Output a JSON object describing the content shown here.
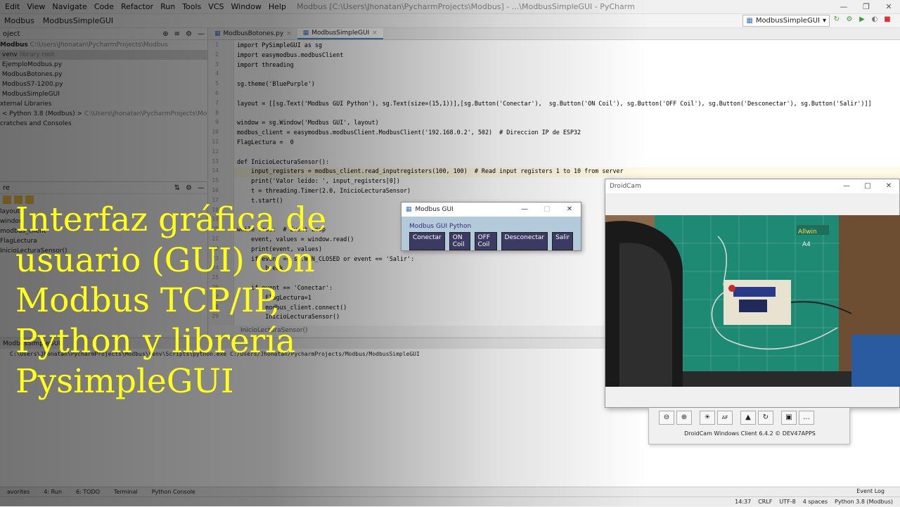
{
  "menu": {
    "items": [
      "Edit",
      "View",
      "Navigate",
      "Code",
      "Refactor",
      "Run",
      "Tools",
      "VCS",
      "Window",
      "Help"
    ],
    "window_title": "Modbus [C:\\Users\\Jhonatan\\PycharmProjects\\Modbus] - ...\\ModbusSimpleGUI - PyCharm"
  },
  "navbar": {
    "crumbs": [
      "Modbus",
      "ModbusSimpleGUI"
    ]
  },
  "run_config": "ModbusSimpleGUI",
  "project": {
    "header": "oject",
    "tree": [
      {
        "name": "Modbus",
        "path": "C:\\Users\\Jhonatan\\PycharmProjects\\Modbus"
      },
      {
        "name": "venv",
        "path": "library root"
      },
      {
        "name": "EjemploModbus.py",
        "path": ""
      },
      {
        "name": "ModbusBotones.py",
        "path": ""
      },
      {
        "name": "ModbusS7-1200.py",
        "path": ""
      },
      {
        "name": "ModbusSimpleGUI",
        "path": ""
      },
      {
        "name": "xternal Libraries",
        "path": ""
      },
      {
        "name": "< Python 3.8 (Modbus) >",
        "path": "C:\\Users\\Jhonatan\\PycharmProjects\\Modbus\\venv\\"
      },
      {
        "name": "cratches and Consoles",
        "path": ""
      }
    ]
  },
  "structure": {
    "header": "re",
    "items": [
      "layout",
      "window",
      "modbus_client",
      "FlagLectura",
      "InicioLecturaSensor()"
    ]
  },
  "tabs": [
    {
      "label": "ModbusBotones.py",
      "active": false
    },
    {
      "label": "ModbusSimpleGUI",
      "active": true
    }
  ],
  "code": [
    {
      "n": "1",
      "t": "import PySimpleGUI as sg"
    },
    {
      "n": "2",
      "t": "import easymodbus.modbusClient"
    },
    {
      "n": "3",
      "t": "import threading"
    },
    {
      "n": "4",
      "t": ""
    },
    {
      "n": "5",
      "t": "sg.theme('BluePurple')"
    },
    {
      "n": "6",
      "t": ""
    },
    {
      "n": "7",
      "t": "layout = [[sg.Text('Modbus GUI Python'), sg.Text(size=(15,1))],[sg.Button('Conectar'),  sg.Button('ON Coil'), sg.Button('OFF Coil'), sg.Button('Desconectar'), sg.Button('Salir')]]"
    },
    {
      "n": "8",
      "t": ""
    },
    {
      "n": "9",
      "t": "window = sg.Window('Modbus GUI', layout)"
    },
    {
      "n": "10",
      "t": "modbus_client = easymodbus.modbusClient.ModbusClient('192.168.0.2', 502)  # Direccion IP de ESP32"
    },
    {
      "n": "11",
      "t": "FlagLectura =  0"
    },
    {
      "n": "12",
      "t": ""
    },
    {
      "n": "13",
      "t": "def InicioLecturaSensor():"
    },
    {
      "n": "14",
      "t": "    input_registers = modbus_client.read_inputregisters(100, 100)  # Read input registers 1 to 10 from server"
    },
    {
      "n": "15",
      "t": "    print('Valor leído: ', input_registers[0])"
    },
    {
      "n": "16",
      "t": "    t = threading.Timer(2.0, InicioLecturaSensor)"
    },
    {
      "n": "17",
      "t": "    t.start()"
    },
    {
      "n": "18",
      "t": ""
    },
    {
      "n": "19",
      "t": ""
    },
    {
      "n": "20",
      "t": "while True:  # Event Loop"
    },
    {
      "n": "21",
      "t": "    event, values = window.read()"
    },
    {
      "n": "22",
      "t": "    print(event, values)"
    },
    {
      "n": "23",
      "t": "    if event == sg.WIN_CLOSED or event == 'Salir':"
    },
    {
      "n": "24",
      "t": "        break"
    },
    {
      "n": "25",
      "t": ""
    },
    {
      "n": "26",
      "t": "    if event == 'Conectar':"
    },
    {
      "n": "27",
      "t": "        FlagLectura=1"
    },
    {
      "n": "28",
      "t": "        modbus_client.connect()"
    },
    {
      "n": "29",
      "t": "        InicioLecturaSensor()"
    }
  ],
  "editor_footer": "InicioLecturaSensor()",
  "run_panel": {
    "tab": "ModbusSimpleGUI",
    "command": "C:\\Users\\Jhonatan\\PycharmProjects\\Modbus\\venv\\Scripts\\python.exe C:/Users/Jhonatan/PycharmProjects/Modbus/ModbusSimpleGUI"
  },
  "bottom_tabs": [
    "avorites",
    "4: Run",
    "6: TODO",
    "Terminal",
    "Python Console"
  ],
  "event_log": "Event Log",
  "status": [
    "14:37",
    "CRLF",
    "UTF-8",
    "4 spaces",
    "Python 3.8 (Modbus)"
  ],
  "gui_window": {
    "title": "Modbus GUI",
    "label": "Modbus GUI Python",
    "buttons": [
      "Conectar",
      "ON Coil",
      "OFF Coil",
      "Desconectar",
      "Salir"
    ]
  },
  "droidcam": {
    "title": "DroidCam",
    "version": "DroidCam Windows Client 6.4.2 © DEV47APPS",
    "board_brand": "Allwin",
    "board_size": "A4"
  },
  "overlay_lines": [
    "Interfaz gráfica de",
    "usuario (GUI) con",
    "Modbus TCP/IP,",
    "Python y librería",
    "PysimpleGUI"
  ]
}
